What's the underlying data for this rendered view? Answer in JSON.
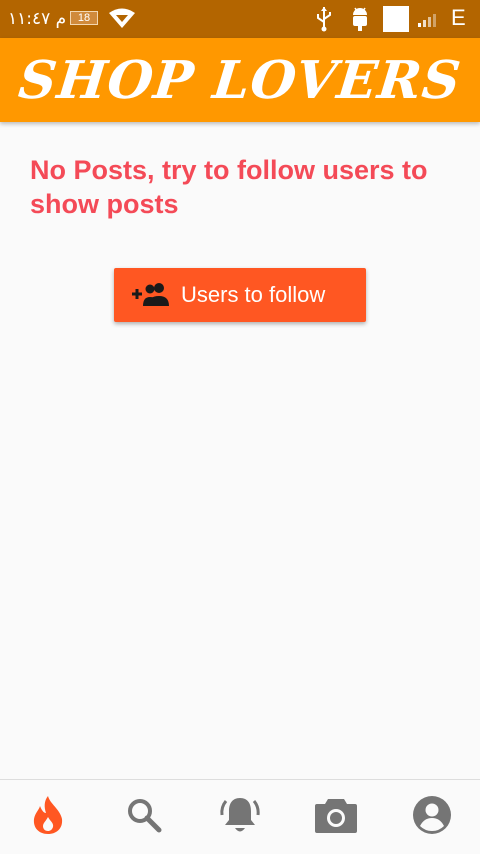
{
  "status_bar": {
    "time": "م ١١:٤٧",
    "battery": "18",
    "network": "E"
  },
  "app_bar": {
    "title": "SHOP LOVERS"
  },
  "main": {
    "empty_message": "No Posts, try to follow users to show posts",
    "follow_button_label": "Users to follow",
    "follow_button_icon": "group-add-icon"
  },
  "bottom_nav": {
    "items": [
      {
        "icon": "flame-icon",
        "active": true
      },
      {
        "icon": "search-icon",
        "active": false
      },
      {
        "icon": "bell-icon",
        "active": false
      },
      {
        "icon": "camera-icon",
        "active": false
      },
      {
        "icon": "account-icon",
        "active": false
      }
    ]
  },
  "colors": {
    "status_bar": "#b36500",
    "app_bar": "#ff9800",
    "message_text": "#f44a57",
    "button": "#ff5722",
    "nav_active": "#ff5722",
    "nav_inactive": "#757575"
  }
}
